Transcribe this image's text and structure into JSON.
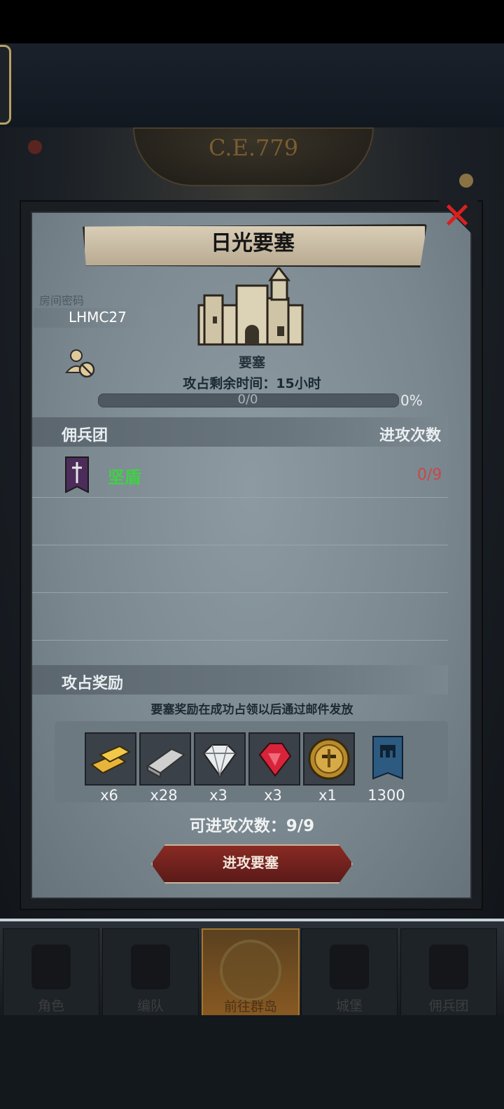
{
  "background": {
    "era": "C.E.779"
  },
  "bottom_nav": {
    "items": [
      {
        "label": "角色",
        "icon": "character-icon",
        "active": false
      },
      {
        "label": "编队",
        "icon": "formation-icon",
        "active": false
      },
      {
        "label": "前往群岛",
        "icon": "islands-icon",
        "active": true
      },
      {
        "label": "城堡",
        "icon": "castle-icon",
        "active": false
      },
      {
        "label": "佣兵团",
        "icon": "mercenary-icon",
        "active": false
      }
    ]
  },
  "modal": {
    "title": "日光要塞",
    "close_icon": "close-icon",
    "room_label": "房间密码",
    "room_code": "LHMC27",
    "fortress_type": "要塞",
    "timer_text": "攻占剩余时间：15小时",
    "progress": {
      "count_text": "0/0",
      "percent_text": "0%",
      "fraction": 0.0
    },
    "mercenary_section": {
      "title": "佣兵团",
      "attacks_header": "进攻次数",
      "rows": [
        {
          "name": "坚盾",
          "attacks": "0/9",
          "name_color": "#3fd243",
          "attacks_color": "#c94848"
        }
      ]
    },
    "reward_section": {
      "title": "攻占奖励",
      "note": "要塞奖励在成功占领以后通过邮件发放",
      "items": [
        {
          "icon": "gold-bar-icon",
          "qty": "x6"
        },
        {
          "icon": "iron-ingot-icon",
          "qty": "x28"
        },
        {
          "icon": "diamond-icon",
          "qty": "x3"
        },
        {
          "icon": "ruby-icon",
          "qty": "x3"
        },
        {
          "icon": "helmet-medal-icon",
          "qty": "x1"
        },
        {
          "icon": "guild-banner-icon",
          "qty": "1300"
        }
      ]
    },
    "attempts_text": "可进攻次数：9/9",
    "attack_button": "进攻要塞"
  },
  "colors": {
    "accent_red": "#8a2a24",
    "green": "#3fd243",
    "red_text": "#c94848"
  }
}
